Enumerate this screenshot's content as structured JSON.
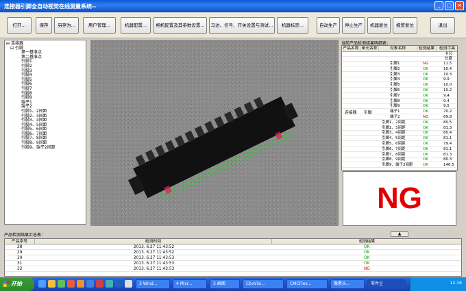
{
  "window": {
    "title": "连接器引脚全自动视觉在线测量系统--",
    "min": "_",
    "max": "□",
    "close": "×"
  },
  "toolbar": {
    "buttons": [
      "打开...",
      "保存",
      "另存为...",
      "用户管理...",
      "机器配置...",
      "相机配置及其参数设置...",
      "马达、信号、开关设置与测试...",
      "机器标定...",
      "自动生产",
      "停止生产",
      "机器复位",
      "报警复位",
      "退出"
    ]
  },
  "tree": {
    "root": "连接器",
    "child": "引脚",
    "items": [
      "第一基准点",
      "第二基准点",
      "引脚1",
      "引脚2",
      "引脚3",
      "引脚4",
      "引脚5",
      "引脚6",
      "引脚7",
      "引脚8",
      "引脚9",
      "端子1",
      "端子2",
      "引脚1、2间距",
      "引脚2、3间距",
      "引脚3、4间距",
      "引脚4、5间距",
      "引脚5、6间距",
      "引脚6、7间距",
      "引脚7、8间距",
      "引脚8、9间距",
      "引脚9、端子2间距"
    ]
  },
  "result": {
    "title": "当前产品检测结果明细表：",
    "headers": [
      "产品名称",
      "单元名称",
      "对象名称",
      "检测结果",
      "检测工具"
    ],
    "product": "连接器",
    "unit": "引脚",
    "extra_header": [
      "卡尺",
      "长度"
    ],
    "rows": [
      {
        "name": "引脚1",
        "res": "NG",
        "val": "11.5"
      },
      {
        "name": "引脚2",
        "res": "OK",
        "val": "10.4"
      },
      {
        "name": "引脚3",
        "res": "OK",
        "val": "10.3"
      },
      {
        "name": "引脚4",
        "res": "OK",
        "val": "9.9"
      },
      {
        "name": "引脚5",
        "res": "OK",
        "val": "10.0"
      },
      {
        "name": "引脚6",
        "res": "OK",
        "val": "10.2"
      },
      {
        "name": "引脚7",
        "res": "OK",
        "val": "9.4"
      },
      {
        "name": "引脚8",
        "res": "OK",
        "val": "9.4"
      },
      {
        "name": "引脚9",
        "res": "OK",
        "val": "9.5"
      },
      {
        "name": "端子1",
        "res": "OK",
        "val": "70.2"
      },
      {
        "name": "端子2",
        "res": "NG",
        "val": "69.8"
      },
      {
        "name": "引脚1、2间距",
        "res": "OK",
        "val": "80.5"
      },
      {
        "name": "引脚2、3间距",
        "res": "OK",
        "val": "81.3"
      },
      {
        "name": "引脚3、4间距",
        "res": "OK",
        "val": "80.4"
      },
      {
        "name": "引脚4、5间距",
        "res": "OK",
        "val": "81.1"
      },
      {
        "name": "引脚5、6间距",
        "res": "OK",
        "val": "79.4"
      },
      {
        "name": "引脚6、7间距",
        "res": "OK",
        "val": "81.1"
      },
      {
        "name": "引脚7、8间距",
        "res": "OK",
        "val": "81.3"
      },
      {
        "name": "引脚8、9间距",
        "res": "OK",
        "val": "80.3"
      },
      {
        "name": "引脚9、端子2间距",
        "res": "OK",
        "val": "146.5"
      }
    ],
    "verdict": "NG",
    "scroll_glyph": "▲"
  },
  "summary": {
    "title": "产品检测结果汇总表：",
    "headers": [
      "产品序号",
      "检测时间",
      "检测结果"
    ],
    "rows": [
      {
        "id": "28",
        "time": "2013. 6.27 11:43:52",
        "res": "OK"
      },
      {
        "id": "29",
        "time": "2013. 6.27 11:43:52",
        "res": "OK"
      },
      {
        "id": "30",
        "time": "2013. 6.27 11:43:53",
        "res": "OK"
      },
      {
        "id": "31",
        "time": "2013. 6.27 11:43:53",
        "res": "OK"
      },
      {
        "id": "32",
        "time": "2013. 6.27 11:43:53",
        "res": "NG"
      }
    ]
  },
  "taskbar": {
    "start": "开始",
    "tasks": [
      "3 Wind...",
      "4 Micr...",
      "3 画图",
      "CbvVisi...",
      "CMCFlex...",
      "像素长...",
      "零件尘"
    ],
    "clock": "12:16"
  },
  "colors": {
    "ok": "#00a000",
    "ng": "#e00000",
    "title_bar": "#0a5bd8"
  }
}
